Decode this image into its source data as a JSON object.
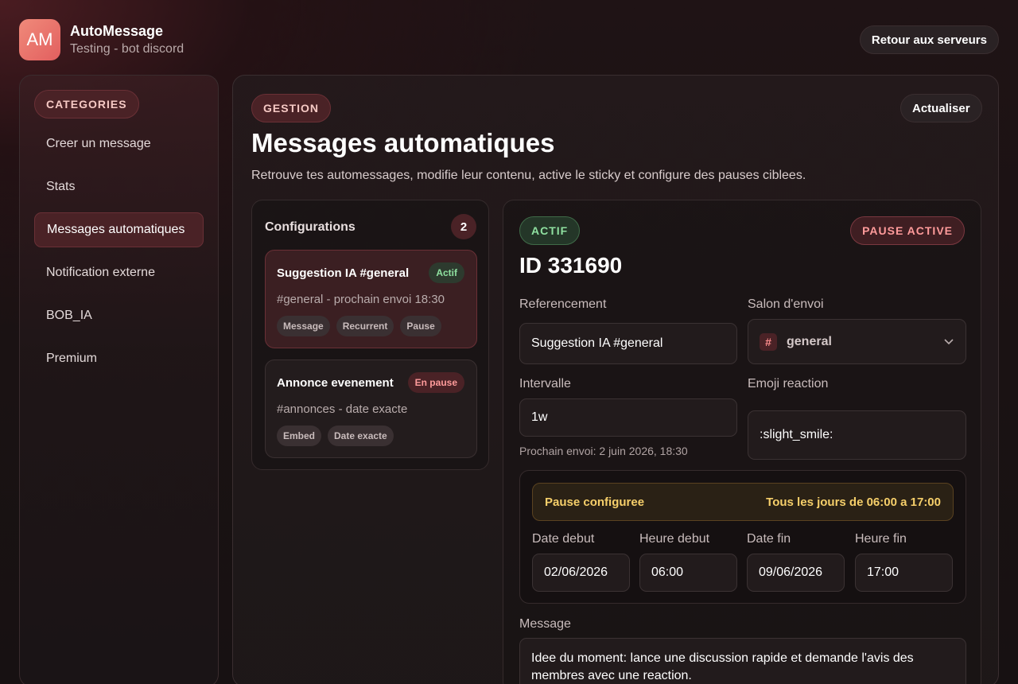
{
  "app": {
    "logo_text": "AM",
    "name": "AutoMessage",
    "subtitle": "Testing - bot discord",
    "back_button": "Retour aux serveurs"
  },
  "sidebar": {
    "category_label": "CATEGORIES",
    "items": [
      {
        "label": "Creer un message",
        "active": false
      },
      {
        "label": "Stats",
        "active": false
      },
      {
        "label": "Messages automatiques",
        "active": true
      },
      {
        "label": "Notification externe",
        "active": false
      },
      {
        "label": "BOB_IA",
        "active": false
      },
      {
        "label": "Premium",
        "active": false
      }
    ]
  },
  "main": {
    "section_pill": "GESTION",
    "refresh_button": "Actualiser",
    "title": "Messages automatiques",
    "description": "Retrouve tes automessages, modifie leur contenu, active le sticky et configure des pauses ciblees."
  },
  "configurations": {
    "title": "Configurations",
    "count": "2",
    "items": [
      {
        "name": "Suggestion IA #general",
        "status": "Actif",
        "meta": "#general - prochain envoi 18:30",
        "tags": [
          "Message",
          "Recurrent",
          "Pause"
        ],
        "selected": true
      },
      {
        "name": "Annonce evenement",
        "status": "En pause",
        "meta": "#annonces - date exacte",
        "tags": [
          "Embed",
          "Date exacte"
        ],
        "selected": false
      }
    ]
  },
  "detail": {
    "status_pill": "ACTIF",
    "pause_pill": "PAUSE ACTIVE",
    "id": "ID 331690",
    "referencement_label": "Referencement",
    "referencement_value": "Suggestion IA #general",
    "salon_label": "Salon d'envoi",
    "salon_hash": "#",
    "salon_value": "general",
    "intervalle_label": "Intervalle",
    "intervalle_value": "1w",
    "next_send": "Prochain envoi: 2 juin 2026, 18:30",
    "emoji_label": "Emoji reaction",
    "emoji_value": ":slight_smile:",
    "pause": {
      "title": "Pause configuree",
      "schedule": "Tous les jours de 06:00 a 17:00",
      "date_debut_label": "Date debut",
      "date_debut": "02/06/2026",
      "heure_debut_label": "Heure debut",
      "heure_debut": "06:00",
      "date_fin_label": "Date fin",
      "date_fin": "09/06/2026",
      "heure_fin_label": "Heure fin",
      "heure_fin": "17:00"
    },
    "message_label": "Message",
    "message_value": "Idee du moment: lance une discussion rapide et demande l'avis des membres avec une reaction."
  }
}
